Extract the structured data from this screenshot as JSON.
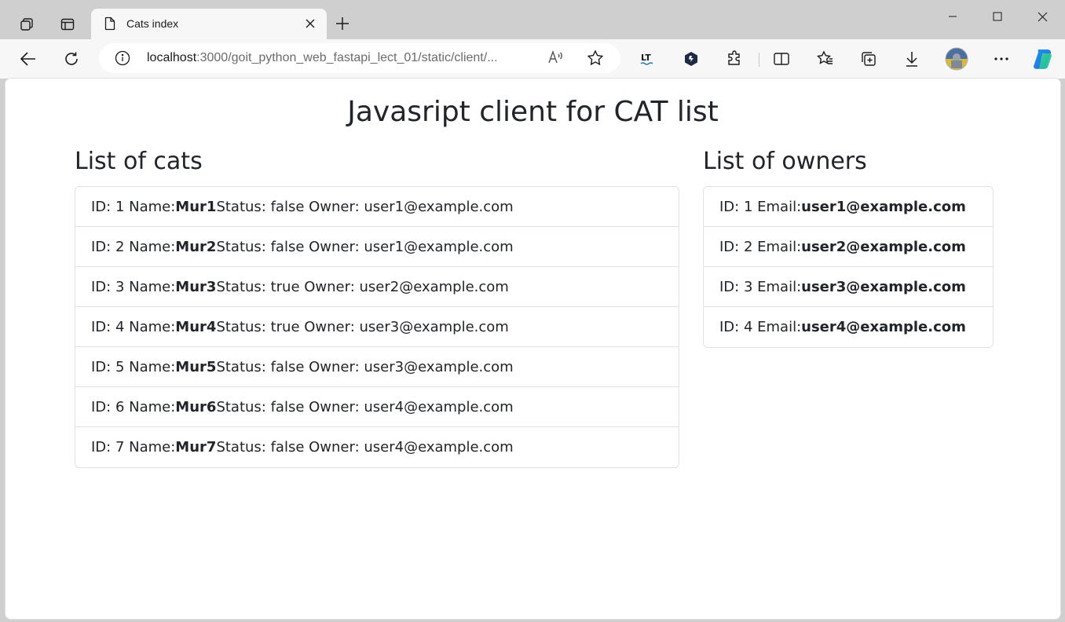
{
  "browser": {
    "tab_title": "Cats index",
    "url_host": "localhost",
    "url_path": ":3000/goit_python_web_fastapi_lect_01/static/client/...",
    "read_aloud_label": "Á̅"
  },
  "page": {
    "heading": "Javasript client for CAT list",
    "cats_title": "List of cats",
    "owners_title": "List of owners",
    "cats": [
      {
        "prefix": "ID: 1 Name: ",
        "name": "Mur1",
        "suffix": " Status: false Owner: user1@example.com"
      },
      {
        "prefix": "ID: 2 Name: ",
        "name": "Mur2",
        "suffix": " Status: false Owner: user1@example.com"
      },
      {
        "prefix": "ID: 3 Name: ",
        "name": "Mur3",
        "suffix": " Status: true Owner: user2@example.com"
      },
      {
        "prefix": "ID: 4 Name: ",
        "name": "Mur4",
        "suffix": " Status: true Owner: user3@example.com"
      },
      {
        "prefix": "ID: 5 Name: ",
        "name": "Mur5",
        "suffix": " Status: false Owner: user3@example.com"
      },
      {
        "prefix": "ID: 6 Name: ",
        "name": "Mur6",
        "suffix": " Status: false Owner: user4@example.com"
      },
      {
        "prefix": "ID: 7 Name: ",
        "name": "Mur7",
        "suffix": " Status: false Owner: user4@example.com"
      }
    ],
    "owners": [
      {
        "prefix": "ID: 1 Email: ",
        "email": "user1@example.com"
      },
      {
        "prefix": "ID: 2 Email: ",
        "email": "user2@example.com"
      },
      {
        "prefix": "ID: 3 Email: ",
        "email": "user3@example.com"
      },
      {
        "prefix": "ID: 4 Email: ",
        "email": "user4@example.com"
      }
    ]
  },
  "colors": {
    "text": "#212529",
    "border": "#dee2e6",
    "chrome": "#cfcfcf",
    "toolbar": "#f7f7f7"
  }
}
